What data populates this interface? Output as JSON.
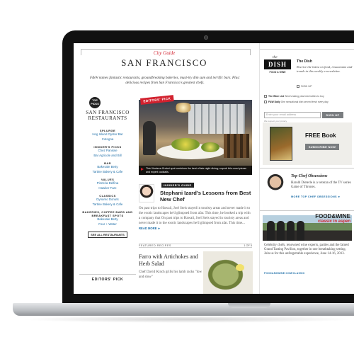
{
  "header": {
    "kicker": "City Guide",
    "title": "SAN FRANCISCO",
    "intro": "F&W names fantastic restaurants, groundbreaking bakeries, must-try dim sum and terrific bars. Plus: delicious recipes from San Francisco's greatest chefs."
  },
  "guide": {
    "badge": "TOP PICKS",
    "title_line1": "SAN FRANCISCO",
    "title_line2": "RESTAURANTS",
    "sections": [
      {
        "heading": "SPLURGE",
        "items": [
          "Hog Island Oyster Bar",
          "Cotogna"
        ]
      },
      {
        "heading": "INSIDER'S PICKS",
        "items": [
          "Chez Panisse",
          "Bar Agricole and Bill"
        ]
      },
      {
        "heading": "BAR",
        "items": [
          "Bakesale Betty",
          "Tartine Bakery & Cafe"
        ]
      },
      {
        "heading": "VALUES",
        "items": [
          "Pizzeria Delfina",
          "Hawker Fare"
        ]
      },
      {
        "heading": "CLASSICS",
        "items": [
          "Dynamo Donuts",
          "Tartine Bakery & Cafe"
        ]
      },
      {
        "heading": "BAKERIES, COFFEE BARS AND BREAKFAST SPOTS",
        "items": [
          "Bakesale Betty",
          "Four + Water"
        ]
      }
    ],
    "see_all": "SEE ALL RESTAURANTS",
    "editors_pick_label": "EDITORS' PICK"
  },
  "hero": {
    "ribbon": "EDITORS' PICK",
    "caption": "This Vinoteca Grotori spot combines the best of late-night dining; superb thin-crust pizzas and expert cocktails."
  },
  "article": {
    "tag": "INSIDER'S GUIDE",
    "title": "Stephani Izard's Lessons from Best New Chef",
    "body": "On past trips to Hawaii, Joel Steis stayed in touristy areas and never made it to the exotic landscapes he'd glimpsed from afar. This time, he booked a trip with a company that On past trips to Hawaii, Joel Steis stayed in touristy areas and never made it to the exotic landscapes he'd glimpsed from afar. This time...",
    "read_more": "READ MORE ►"
  },
  "featured": {
    "label": "FEATURED RECIPES",
    "count": "1 OF 5",
    "title": "Farro with Artichokes and Herb Salad",
    "body": "Chef David Kinch grills his lamb racks \"low and slow\""
  },
  "dish": {
    "logo_the": "the",
    "logo_word": "DISH",
    "logo_brand": "FOOD & WINE",
    "heading": "The Dish",
    "description": "Receive the latest on food, restaurants and trends in this weekly e-newsletter.",
    "signup_label": "SIGN UP",
    "newsletters": [
      {
        "name": "The Wine List",
        "desc": "Wine's taking plus best bottles to buy"
      },
      {
        "name": "F&W Daily",
        "desc": "One sensational dish served fresh every day"
      }
    ],
    "email_placeholder": "Enter your email address",
    "button": "SIGN UP",
    "privacy": "We respect your privacy"
  },
  "promo": {
    "title": "FREE Book",
    "button": "SUBSCRIBE NOW"
  },
  "obsessions": {
    "title": "Top Chef Obsessions",
    "description": "Harold Dieterle is a veteran of the TV series Game of Thrones.",
    "link": "MORE TOP CHEF OBSESSIONS ►"
  },
  "classic": {
    "logo_top": "FOOD&WINE",
    "logo_bottom": "classic in aspen",
    "description": "Celebrity chefs, renowned wine experts, parties and the famed Grand Tasting Pavilion, together in one breathtaking setting. Join us for this unforgettable experience, June 14-16, 2013.",
    "link": "FOODANDWINE.COM/CLASSIC"
  },
  "colors": {
    "accent": "#d2212e",
    "link": "#1f6fa8",
    "button": "#7a7d80"
  }
}
